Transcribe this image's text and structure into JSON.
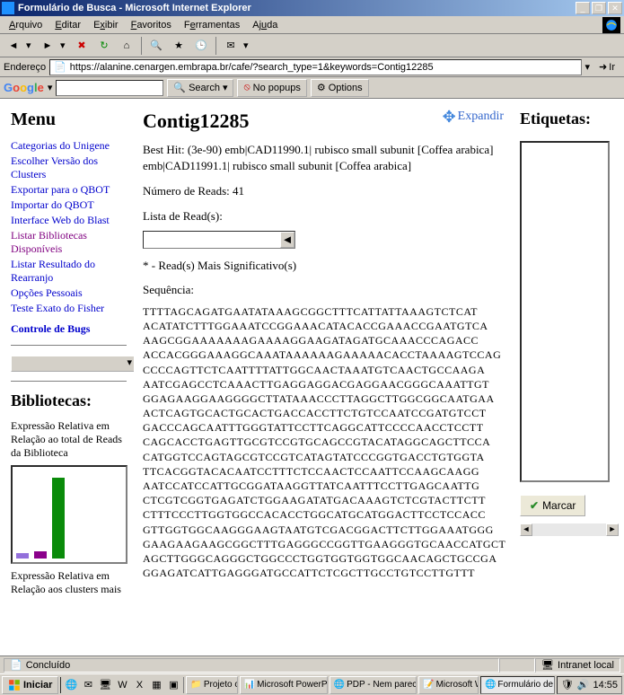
{
  "window": {
    "title": "Formulário de Busca - Microsoft Internet Explorer"
  },
  "menubar": {
    "items": [
      "Arquivo",
      "Editar",
      "Exibir",
      "Favoritos",
      "Ferramentas",
      "Ajuda"
    ]
  },
  "addressbar": {
    "label": "Endereço",
    "url": "https://alanine.cenargen.embrapa.br/cafe/?search_type=1&keywords=Contig12285",
    "go": "Ir"
  },
  "googlebar": {
    "search_btn": "Search",
    "popups_btn": "No popups",
    "options_btn": "Options"
  },
  "left": {
    "menu_title": "Menu",
    "links": [
      {
        "label": "Categorias do Unigene",
        "visited": false
      },
      {
        "label": "Escolher Versão dos Clusters",
        "visited": false
      },
      {
        "label": "Exportar para o QBOT",
        "visited": false
      },
      {
        "label": "Importar do QBOT",
        "visited": false
      },
      {
        "label": "Interface Web do Blast",
        "visited": false
      },
      {
        "label": "Listar Bibliotecas Disponíveis",
        "visited": true
      },
      {
        "label": "Listar Resultado do Rearranjo",
        "visited": false
      },
      {
        "label": "Opções Pessoais",
        "visited": false
      },
      {
        "label": "Teste Exato do Fisher",
        "visited": false
      }
    ],
    "bugs_link": "Controle de Bugs",
    "bib_title": "Bibliotecas:",
    "bib_desc1": "Expressão Relativa em Relação ao total de Reads da Biblioteca",
    "bib_desc2": "Expressão Relativa em Relação aos clusters mais"
  },
  "mid": {
    "title": "Contig12285",
    "expand": "Expandir",
    "besthit": "Best Hit: (3e-90) emb|CAD11990.1| rubisco small subunit [Coffea arabica] emb|CAD11991.1| rubisco small subunit [Coffea arabica]",
    "reads": "Número de Reads: 41",
    "lista": "Lista de Read(s):",
    "signif": "* - Read(s) Mais Significativo(s)",
    "seq_label": "Sequência:",
    "sequence": "TTTTAGCAGATGAATATAAAGCGGCTTTCATTATTAAAGTCTCAT\nACATATCTTTGGAAATCCGGAAACATACACCGAAACCGAATGTCA\nAAGCGGAAAAAAAGAAAAGGAAGATAGATGCAAACCCAGACC\nACCACGGGAAAGGCAAATAAAAAAGAAAAACACCTAAAAGTCCAG\nCCCCAGTTCTCAATTTTATTGGCAACTAAATGTCAACTGCCAAGA\nAATCGAGCCTCAAACTTGAGGAGGACGAGGAACGGGCAAATTGT\nGGAGAAGGAAGGGGCTTATAAACCCTTAGGCTTGGCGGCAATGAA\nACTCAGTGCACTGCACTGACCACCTTCTGTCCAATCCGATGTCCT\nGACCCAGCAATTTGGGTATTCCTTCAGGCATTCCCCAACCTCCTT\nCAGCACCTGAGTTGCGTCCGTGCAGCCGTACATAGGCAGCTTCCA\nCATGGTCCAGTAGCGTCCGTCATAGTATCCCGGTGACCTGTGGTA\nTTCACGGTACACAATCCTTTCTCCAACTCCAATTCCAAGCAAGG\nAATCCATCCATTGCGGATAAGGTTATCAATTTCCTTGAGCAATTG\nCTCGTCGGTGAGATCTGGAAGATATGACAAAGTCTCGTACTTCTT\nCTTTCCCTTGGTGGCCACACCTGGCATGCATGGACTTCCTCCACC\nGTTGGTGGCAAGGGAAGTAATGTCGACGGACTTCTTGGAAATGGG\nGAAGAAGAAGCGGCTTTGAGGGCCGGTTGAAGGGTGCAACCATGCT\nAGCTTGGGCAGGGCTGGCCCTGGTGGTGGTGGCAACAGCTGCCGA\nGGAGATCATTGAGGGATGCCATTCTCGCTTGCCTGTCCTTGTTT"
  },
  "right": {
    "title": "Etiquetas:",
    "marcar": "Marcar"
  },
  "statusbar": {
    "status": "Concluído",
    "zone": "Intranet local"
  },
  "taskbar": {
    "start": "Iniciar",
    "tasks": [
      {
        "label": "Projeto café",
        "active": false
      },
      {
        "label": "Microsoft PowerPoint - ...",
        "active": false
      },
      {
        "label": "PDP - Nem parece inte...",
        "active": false
      },
      {
        "label": "Microsoft Word",
        "active": false
      },
      {
        "label": "Formulário de Bus...",
        "active": true
      }
    ],
    "time": "14:55"
  }
}
